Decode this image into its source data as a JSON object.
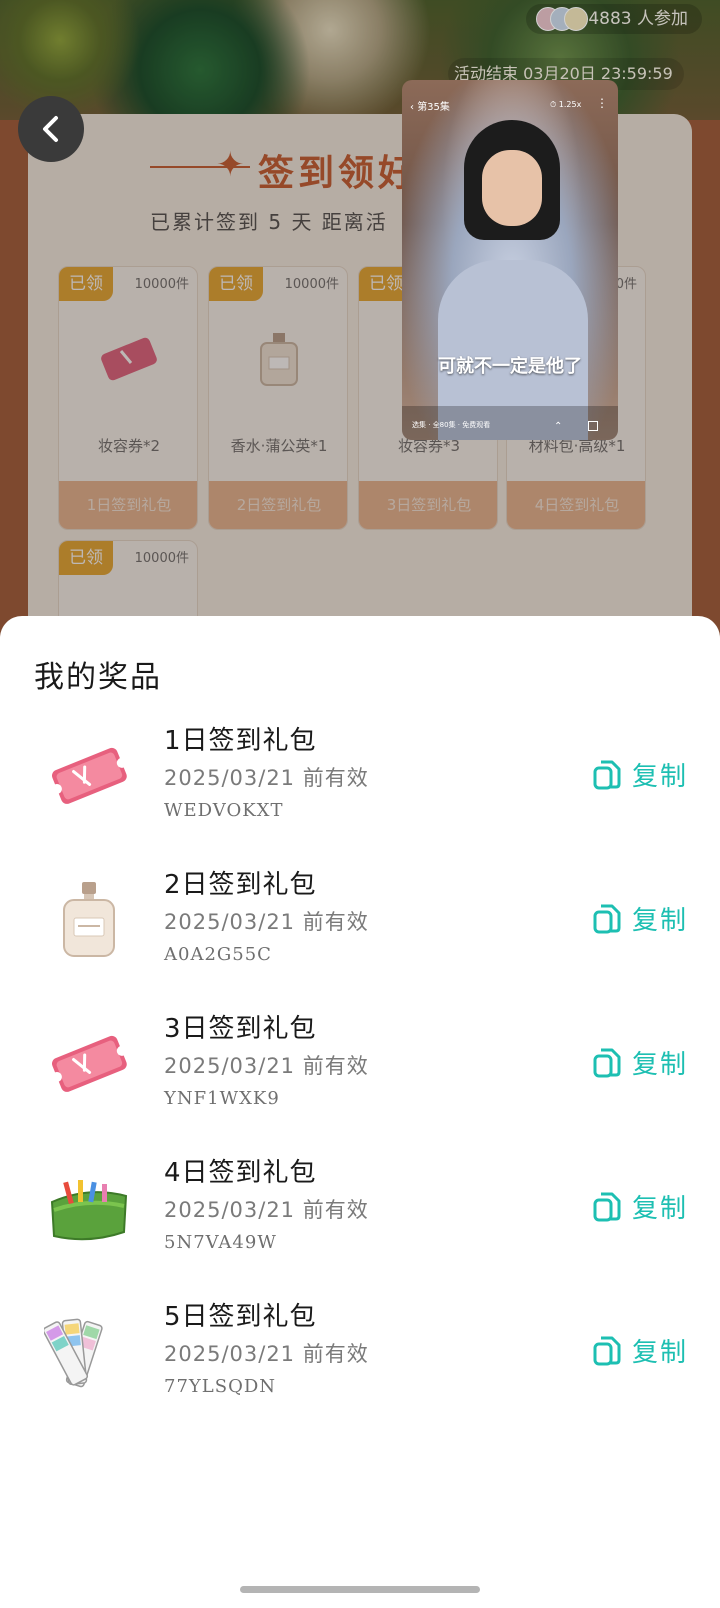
{
  "activity": {
    "participants": "4883 人参加",
    "end_time": "活动结束 03月20日 23:59:59",
    "title": "签到领好",
    "subtitle": "已累计签到 5 天  距离活",
    "cards": [
      {
        "tag": "已领",
        "count": "10000件",
        "name": "妆容券*2",
        "button": "1日签到礼包",
        "icon": "ticket-icon"
      },
      {
        "tag": "已领",
        "count": "10000件",
        "name": "香水·蒲公英*1",
        "button": "2日签到礼包",
        "icon": "perfume-icon"
      },
      {
        "tag": "已领",
        "count": "",
        "name": "妆容券*3",
        "button": "3日签到礼包",
        "icon": "ticket-icon"
      },
      {
        "tag": "",
        "count": "10000件",
        "name": "材料包·高级*1",
        "button": "4日签到礼包",
        "icon": "bag-icon"
      },
      {
        "tag": "已领",
        "count": "10000件",
        "name": "",
        "button": "",
        "icon": "swatch-icon"
      }
    ]
  },
  "video": {
    "episode": "第35集",
    "speed": "1.25x",
    "subtitle": "可就不一定是他了",
    "info": "选集 · 全80集 · 免费观看"
  },
  "sheet": {
    "title": "我的奖品",
    "copy_label": "复制",
    "prizes": [
      {
        "name": "1日签到礼包",
        "date": "2025/03/21 前有效",
        "code": "WEDVOKXT",
        "icon": "ticket-icon"
      },
      {
        "name": "2日签到礼包",
        "date": "2025/03/21 前有效",
        "code": "A0A2G55C",
        "icon": "perfume-icon"
      },
      {
        "name": "3日签到礼包",
        "date": "2025/03/21 前有效",
        "code": "YNF1WXK9",
        "icon": "ticket-icon"
      },
      {
        "name": "4日签到礼包",
        "date": "2025/03/21 前有效",
        "code": "5N7VA49W",
        "icon": "bag-icon"
      },
      {
        "name": "5日签到礼包",
        "date": "2025/03/21 前有效",
        "code": "77YLSQDN",
        "icon": "swatch-icon"
      }
    ]
  },
  "colors": {
    "accent": "#1dbfb2",
    "tag": "#e6a830",
    "title": "#c65a2e"
  }
}
